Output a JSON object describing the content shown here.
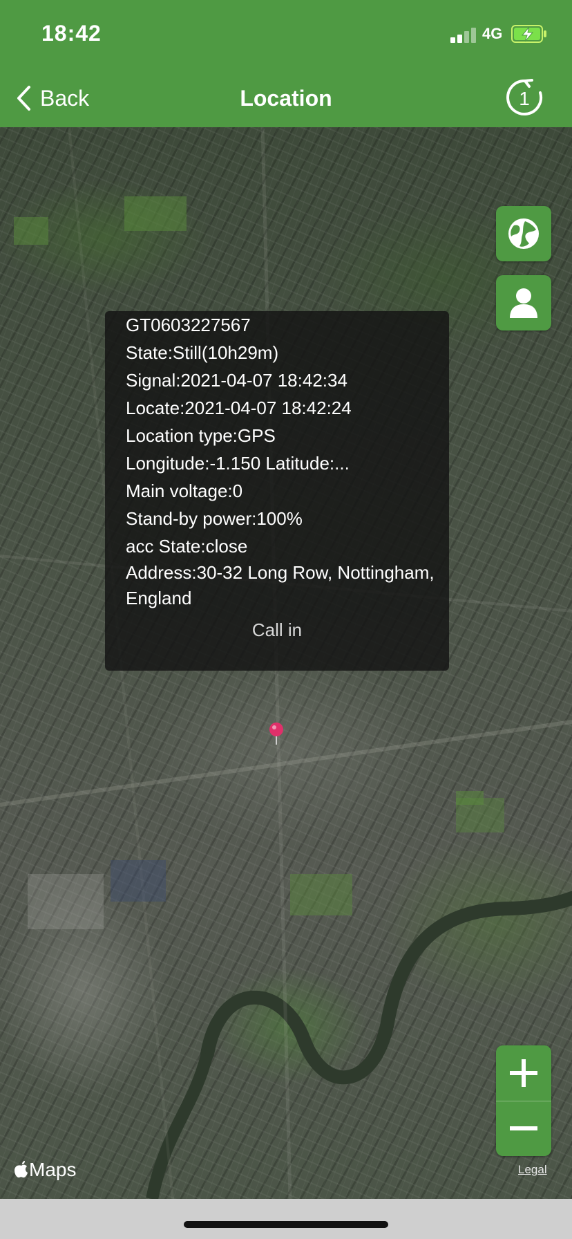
{
  "status_bar": {
    "time": "18:42",
    "network": "4G",
    "signal_bars": 2,
    "battery_state": "charging"
  },
  "nav": {
    "back_label": "Back",
    "title": "Location",
    "refresh_count": "1",
    "refresh_icon": "refresh-countdown-icon"
  },
  "map_controls": {
    "map_type_icon": "globe-icon",
    "user_icon": "person-icon",
    "zoom_in_icon": "plus-icon",
    "zoom_out_icon": "minus-icon"
  },
  "info": {
    "device_id": "GT0603227567",
    "state": "State:Still(10h29m)",
    "signal": "Signal:2021-04-07 18:42:34",
    "locate": "Locate:2021-04-07 18:42:24",
    "location_type": "Location type:GPS",
    "coordinates": "Longitude:-1.150  Latitude:...",
    "main_voltage": "Main voltage:0",
    "standby_power": "Stand-by power:100%",
    "acc_state": "acc State:close",
    "address": "Address:30-32 Long Row, Nottingham, England",
    "call_in": "Call in"
  },
  "map_attribution": {
    "logo": "Maps",
    "legal": "Legal"
  },
  "colors": {
    "accent": "#4f9a43",
    "pin": "#e0306a",
    "popup_bg": "rgba(20,20,20,0.82)"
  }
}
